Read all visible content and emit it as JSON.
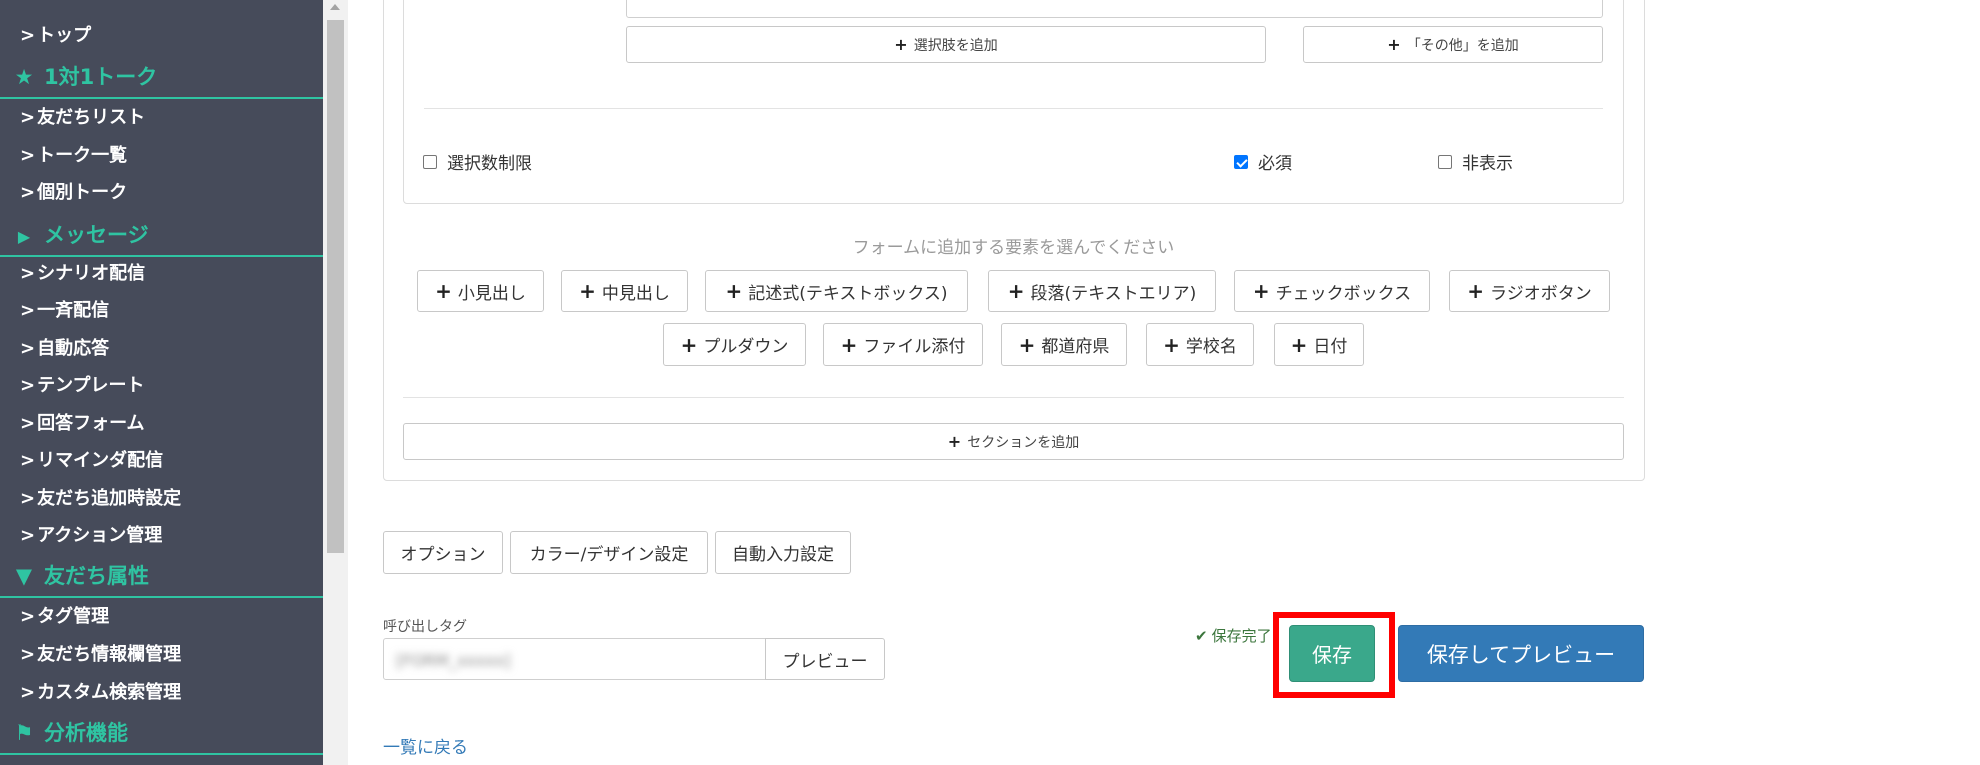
{
  "sidebar": {
    "items": [
      {
        "label": "トップ",
        "type": "item"
      },
      {
        "label": "1対1トーク",
        "type": "section",
        "icon": "star-icon",
        "glyph": "★"
      },
      {
        "label": "友だちリスト",
        "type": "item"
      },
      {
        "label": "トーク一覧",
        "type": "item"
      },
      {
        "label": "個別トーク",
        "type": "item"
      },
      {
        "label": "メッセージ",
        "type": "section",
        "icon": "megaphone-icon",
        "glyph": "📢"
      },
      {
        "label": "シナリオ配信",
        "type": "item"
      },
      {
        "label": "一斉配信",
        "type": "item"
      },
      {
        "label": "自動応答",
        "type": "item"
      },
      {
        "label": "テンプレート",
        "type": "item"
      },
      {
        "label": "回答フォーム",
        "type": "item"
      },
      {
        "label": "リマインダ配信",
        "type": "item"
      },
      {
        "label": "友だち追加時設定",
        "type": "item"
      },
      {
        "label": "アクション管理",
        "type": "item"
      },
      {
        "label": "友だち属性",
        "type": "section",
        "icon": "filter-icon",
        "glyph": "▼"
      },
      {
        "label": "タグ管理",
        "type": "item"
      },
      {
        "label": "友だち情報欄管理",
        "type": "item"
      },
      {
        "label": "カスタム検索管理",
        "type": "item"
      },
      {
        "label": "分析機能",
        "type": "section",
        "icon": "flag-icon",
        "glyph": "⚑"
      }
    ]
  },
  "question_card": {
    "add_option_label": "選択肢を追加",
    "add_other_label": "「その他」を追加",
    "limit_selection_label": "選択数制限",
    "limit_selection_checked": false,
    "required_label": "必須",
    "required_checked": true,
    "hidden_label": "非表示",
    "hidden_checked": false
  },
  "element_picker": {
    "hint": "フォームに追加する要素を選んでください",
    "row1": [
      "小見出し",
      "中見出し",
      "記述式(テキストボックス)",
      "段落(テキストエリア)",
      "チェックボックス",
      "ラジオボタン"
    ],
    "row2": [
      "プルダウン",
      "ファイル添付",
      "都道府県",
      "学校名",
      "日付"
    ]
  },
  "add_section_label": "セクションを追加",
  "tabs": {
    "options": "オプション",
    "color_design": "カラー/デザイン設定",
    "auto_input": "自動入力設定"
  },
  "call_tag": {
    "label": "呼び出しタグ",
    "value": "[FORM_xxxxx]",
    "preview_button": "プレビュー"
  },
  "status": {
    "saved_text": "保存完了"
  },
  "actions": {
    "save": "保存",
    "save_and_preview": "保存してプレビュー"
  },
  "back_link": "一覧に戻る",
  "colors": {
    "sidebar_bg": "#464b5a",
    "accent_green": "#2fc4a2",
    "save_button": "#3aa88b",
    "primary_blue": "#337ab7",
    "highlight_red": "#ff0000"
  }
}
